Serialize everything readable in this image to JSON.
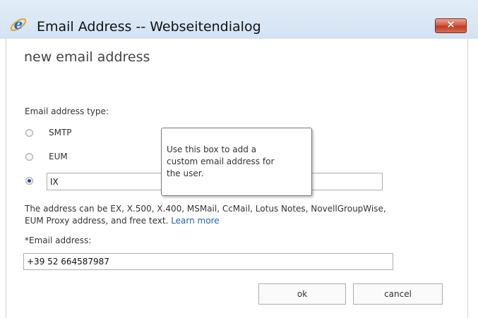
{
  "window": {
    "title": "Email Address -- Webseitendialog",
    "close_label": "✕"
  },
  "dialog": {
    "heading": "new email address",
    "type_label": "Email address type:",
    "options": [
      {
        "label": "SMTP",
        "checked": false
      },
      {
        "label": "EUM",
        "checked": false
      },
      {
        "label": "",
        "checked": true
      }
    ],
    "custom_value": "IX",
    "tooltip": "Use this box to add a custom email address for the user.",
    "help_text": "The address can be EX, X.500, X.400, MSMail, CcMail, Lotus Notes, NovellGroupWise, EUM Proxy address, and free text.",
    "learn_more": "Learn more",
    "email_label": "*Email address:",
    "email_value": "+39 52 664587987",
    "ok_label": "ok",
    "cancel_label": "cancel"
  },
  "icons": {
    "app": "internet-explorer-icon",
    "close": "close-icon"
  },
  "colors": {
    "titlebar": "#d3e2f3",
    "close_button": "#c7432a",
    "link": "#1a64b8",
    "radio_selected": "#1f4e8a"
  }
}
